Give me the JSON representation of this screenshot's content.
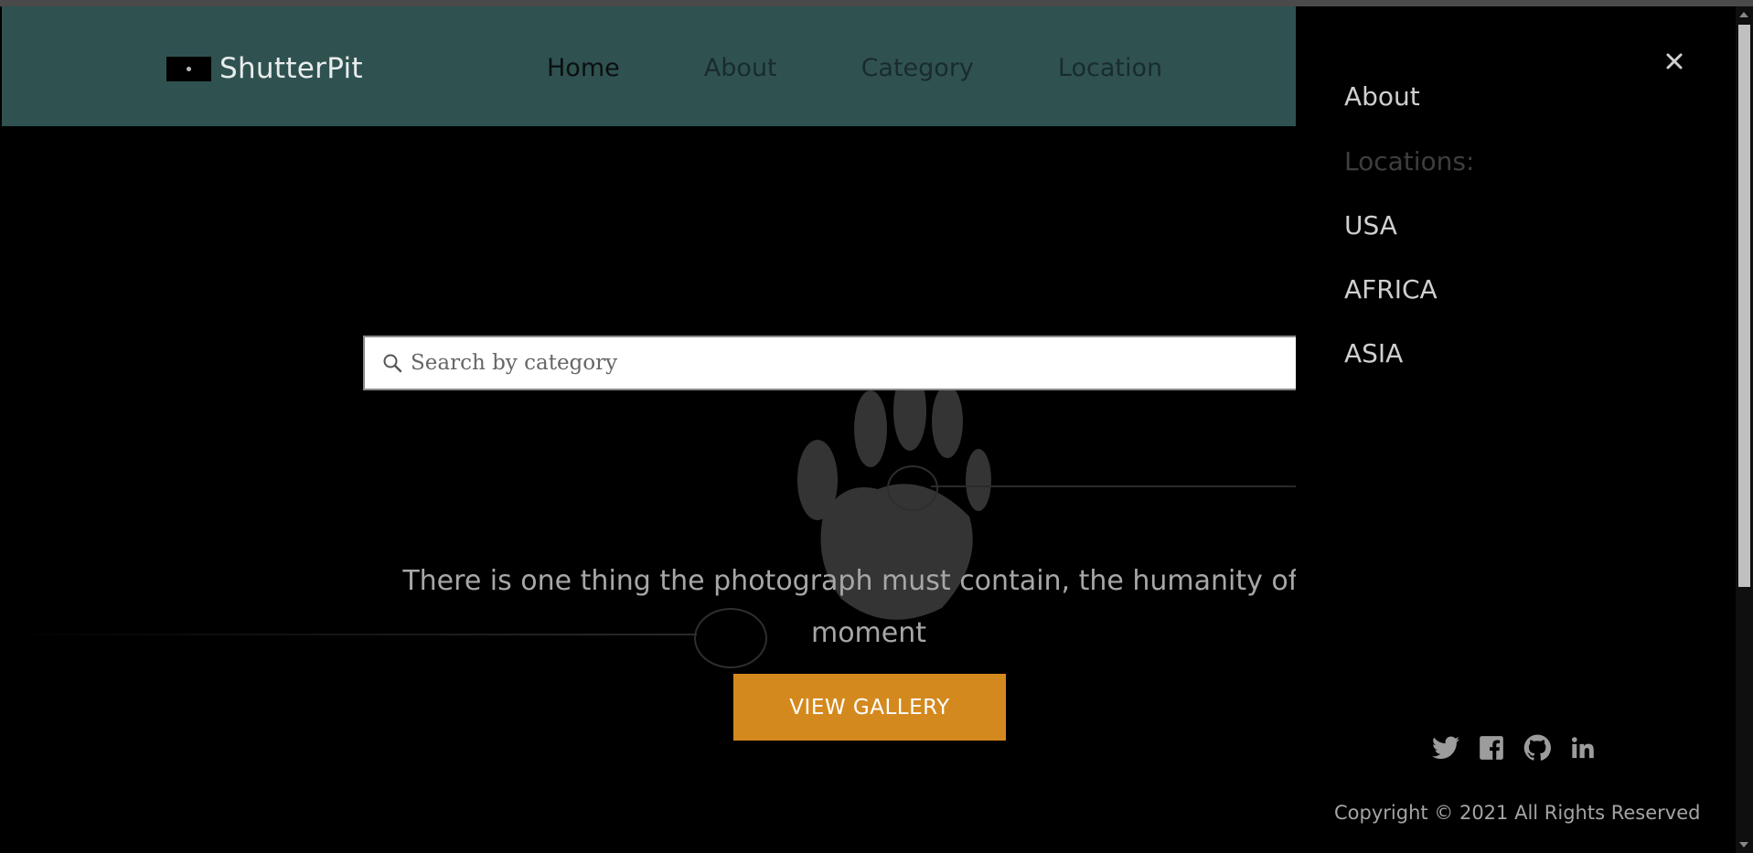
{
  "header": {
    "logo_text": "ShutterPit",
    "nav": [
      {
        "label": "Home",
        "active": true
      },
      {
        "label": "About",
        "active": false
      },
      {
        "label": "Category",
        "active": false
      },
      {
        "label": "Location",
        "active": false
      }
    ]
  },
  "hero": {
    "search_placeholder": "Search by category",
    "quote_line1": "There is one thing the photograph must contain, the humanity of th",
    "quote_line2": "moment",
    "cta_label": "VIEW GALLERY"
  },
  "drawer": {
    "close_label": "×",
    "about_label": "About",
    "locations_label": "Locations:",
    "locations": [
      "USA",
      "AFRICA",
      "ASIA"
    ],
    "social_icons": [
      "twitter-icon",
      "facebook-icon",
      "github-icon",
      "linkedin-icon"
    ],
    "copyright": "Copyright © 2021 All Rights Reserved"
  },
  "colors": {
    "header_bg": "#2f5251",
    "cta_bg": "#d4891f",
    "page_bg": "#000000"
  }
}
